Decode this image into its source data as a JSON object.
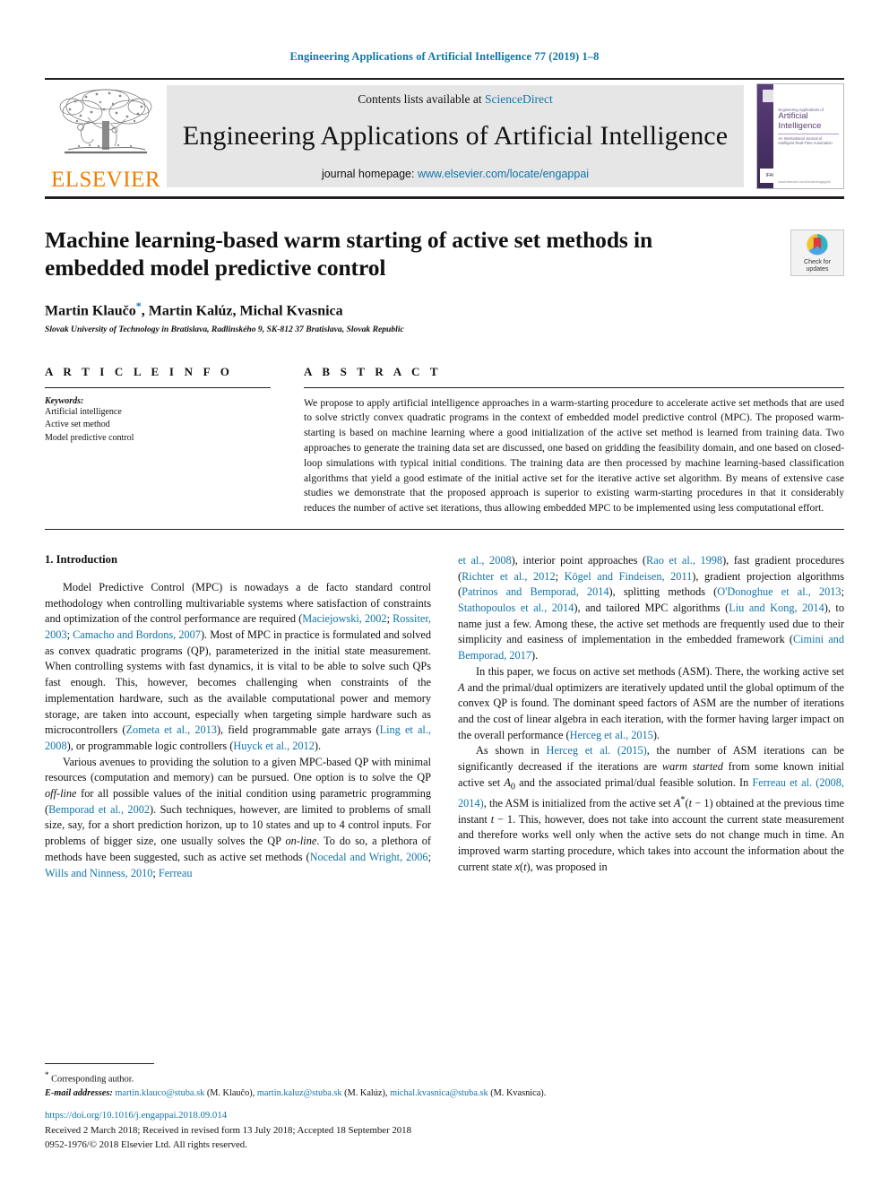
{
  "running_head": "Engineering Applications of Artificial Intelligence 77 (2019) 1–8",
  "masthead": {
    "publisher_logo_text": "ELSEVIER",
    "contents_prefix": "Contents lists available at",
    "contents_link": "ScienceDirect",
    "journal_title": "Engineering Applications of Artificial Intelligence",
    "homepage_prefix": "journal homepage:",
    "homepage_link": "www.elsevier.com/locate/engappai",
    "cover": {
      "sub_line": "Engineering Applications of",
      "title_line_1": "Artificial",
      "title_line_2": "Intelligence",
      "tagline": "An International Journal of Intelligent Real-Time Automation",
      "footer": "www.elsevier.com/locate/engappai",
      "badge": "IFAC"
    }
  },
  "article": {
    "title": "Machine learning-based warm starting of active set methods in embedded model predictive control",
    "authors": "Martin Klaučo, Martin Kalúz, Michal Kvasnica",
    "author_star": "*",
    "affiliation": "Slovak University of Technology in Bratislava, Radlinského 9, SK-812 37 Bratislava, Slovak Republic",
    "crossmark_label": "Check for\nupdates"
  },
  "info": {
    "heading": "A R T I C L E   I N F O",
    "keywords_label": "Keywords:",
    "keywords": [
      "Artificial intelligence",
      "Active set method",
      "Model predictive control"
    ]
  },
  "abstract": {
    "heading": "A B S T R A C T",
    "text": "We propose to apply artificial intelligence approaches in a warm-starting procedure to accelerate active set methods that are used to solve strictly convex quadratic programs in the context of embedded model predictive control (MPC). The proposed warm-starting is based on machine learning where a good initialization of the active set method is learned from training data. Two approaches to generate the training data set are discussed, one based on gridding the feasibility domain, and one based on closed-loop simulations with typical initial conditions. The training data are then processed by machine learning-based classification algorithms that yield a good estimate of the initial active set for the iterative active set algorithm. By means of extensive case studies we demonstrate that the proposed approach is superior to existing warm-starting procedures in that it considerably reduces the number of active set iterations, thus allowing embedded MPC to be implemented using less computational effort."
  },
  "body": {
    "section_number_title": "1.  Introduction",
    "left_paragraphs": [
      "Model Predictive Control (MPC) is nowadays a de facto standard control methodology when controlling multivariable systems where satisfaction of constraints and optimization of the control performance are required (Maciejowski, 2002; Rossiter, 2003; Camacho and Bordons, 2007). Most of MPC in practice is formulated and solved as convex quadratic programs (QP), parameterized in the initial state measurement. When controlling systems with fast dynamics, it is vital to be able to solve such QPs fast enough. This, however, becomes challenging when constraints of the implementation hardware, such as the available computational power and memory storage, are taken into account, especially when targeting simple hardware such as microcontrollers (Zometa et al., 2013), field programmable gate arrays (Ling et al., 2008), or programmable logic controllers (Huyck et al., 2012).",
      "Various avenues to providing the solution to a given MPC-based QP with minimal resources (computation and memory) can be pursued. One option is to solve the QP off-line for all possible values of the initial condition using parametric programming (Bemporad et al., 2002). Such techniques, however, are limited to problems of small size, say, for a short prediction horizon, up to 10 states and up to 4 control inputs. For problems of bigger size, one usually solves the QP on-line. To do so, a plethora of methods have been suggested, such as active set methods (Nocedal and Wright, 2006; Wills and Ninness, 2010; Ferreau"
    ],
    "right_paragraphs": [
      "et al., 2008), interior point approaches (Rao et al., 1998), fast gradient procedures (Richter et al., 2012; Kögel and Findeisen, 2011), gradient projection algorithms (Patrinos and Bemporad, 2014), splitting methods (O'Donoghue et al., 2013; Stathopoulos et al., 2014), and tailored MPC algorithms (Liu and Kong, 2014), to name just a few. Among these, the active set methods are frequently used due to their simplicity and easiness of implementation in the embedded framework (Cimini and Bemporad, 2017).",
      "In this paper, we focus on active set methods (ASM). There, the working active set A and the primal/dual optimizers are iteratively updated until the global optimum of the convex QP is found. The dominant speed factors of ASM are the number of iterations and the cost of linear algebra in each iteration, with the former having larger impact on the overall performance (Herceg et al., 2015).",
      "As shown in Herceg et al. (2015), the number of ASM iterations can be significantly decreased if the iterations are warm started from some known initial active set A₀ and the associated primal/dual feasible solution. In Ferreau et al. (2008, 2014), the ASM is initialized from the active set A*(t − 1) obtained at the previous time instant t − 1. This, however, does not take into account the current state measurement and therefore works well only when the active sets do not change much in time. An improved warm starting procedure, which takes into account the information about the current state x(t), was proposed in"
    ],
    "references_inline": [
      "Maciejowski, 2002",
      "Rossiter, 2003",
      "Camacho and Bordons, 2007",
      "Zometa et al., 2013",
      "Ling et al., 2008",
      "Huyck et al., 2012",
      "Bemporad et al., 2002",
      "Nocedal and Wright, 2006",
      "Wills and Ninness, 2010",
      "Ferreau et al., 2008",
      "Rao et al., 1998",
      "Richter et al., 2012",
      "Kögel and Findeisen, 2011",
      "Patrinos and Bemporad, 2014",
      "O'Donoghue et al., 2013",
      "Stathopoulos et al., 2014",
      "Liu and Kong, 2014",
      "Cimini and Bemporad, 2017",
      "Herceg et al., 2015",
      "Ferreau et al. (2008, 2014)"
    ]
  },
  "footnote": {
    "corresponding": "Corresponding author.",
    "email_label": "E-mail addresses:",
    "emails": [
      {
        "address": "martin.klauco@stuba.sk",
        "name": "(M. Klaučo)"
      },
      {
        "address": "martin.kaluz@stuba.sk",
        "name": "(M. Kalúz)"
      },
      {
        "address": "michal.kvasnica@stuba.sk",
        "name": "(M. Kvasnica)."
      }
    ]
  },
  "footer": {
    "doi": "https://doi.org/10.1016/j.engappai.2018.09.014",
    "dates": "Received 2 March 2018; Received in revised form 13 July 2018; Accepted 18 September 2018",
    "copyright": "0952-1976/© 2018 Elsevier Ltd. All rights reserved."
  },
  "colors": {
    "link": "#1175a8",
    "elsevier_orange": "#ef7d00",
    "masthead_band": "#e6e6e6",
    "rule": "#231f20",
    "cover_purple": "#4b3268"
  }
}
